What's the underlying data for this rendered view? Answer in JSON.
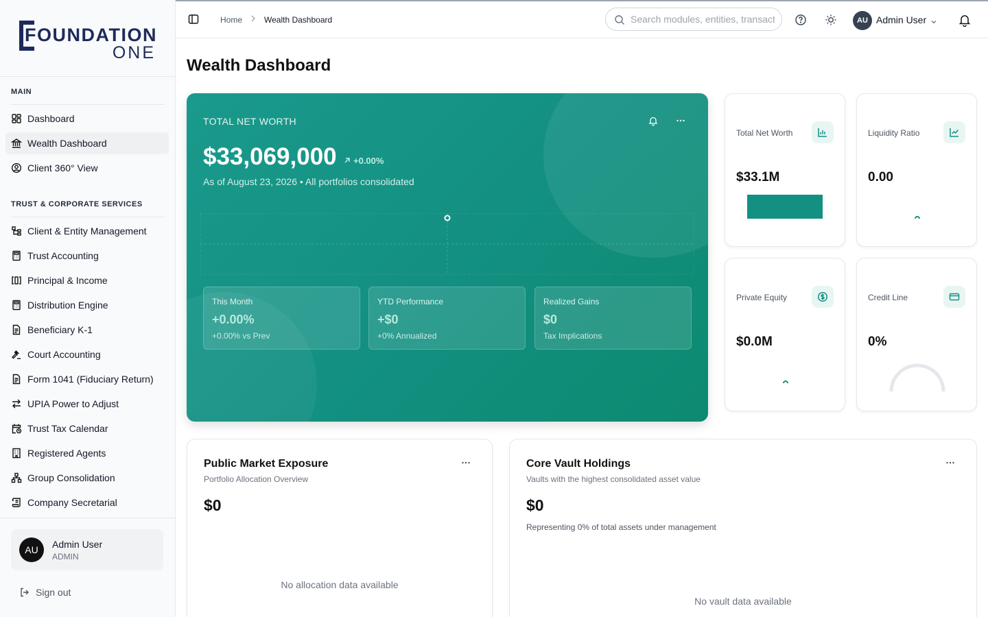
{
  "app": {
    "logo_word1": "FOUNDATION",
    "logo_word2": "ONE"
  },
  "sidebar": {
    "sections": [
      {
        "title": "MAIN"
      },
      {
        "title": "TRUST & CORPORATE SERVICES"
      }
    ],
    "main_items": [
      {
        "label": "Dashboard",
        "icon": "dashboard-grid-icon",
        "active": false
      },
      {
        "label": "Wealth Dashboard",
        "icon": "bank-icon",
        "active": true
      },
      {
        "label": "Client 360° View",
        "icon": "user-circle-icon",
        "active": false
      }
    ],
    "trust_items": [
      {
        "label": "Client & Entity Management",
        "icon": "hierarchy-icon"
      },
      {
        "label": "Trust Accounting",
        "icon": "calculator-icon"
      },
      {
        "label": "Principal & Income",
        "icon": "split-columns-icon"
      },
      {
        "label": "Distribution Engine",
        "icon": "calculator-icon"
      },
      {
        "label": "Beneficiary K-1",
        "icon": "document-icon"
      },
      {
        "label": "Court Accounting",
        "icon": "gavel-icon"
      },
      {
        "label": "Form 1041 (Fiduciary Return)",
        "icon": "document-icon"
      },
      {
        "label": "UPIA Power to Adjust",
        "icon": "arrows-exchange-icon"
      },
      {
        "label": "Trust Tax Calendar",
        "icon": "calendar-clock-icon"
      },
      {
        "label": "Registered Agents",
        "icon": "building-icon"
      },
      {
        "label": "Group Consolidation",
        "icon": "network-icon"
      },
      {
        "label": "Company Secretarial",
        "icon": "scroll-icon"
      }
    ],
    "user": {
      "initials": "AU",
      "name": "Admin User",
      "role": "ADMIN"
    },
    "signout_label": "Sign out"
  },
  "header": {
    "breadcrumb": [
      "Home",
      "Wealth Dashboard"
    ],
    "search_placeholder": "Search modules, entities, transactions...",
    "user_initials": "AU",
    "user_name": "Admin User"
  },
  "main": {
    "page_title": "Wealth Dashboard",
    "hero": {
      "label": "TOTAL NET WORTH",
      "value": "$33,069,000",
      "delta": "+0.00%",
      "as_of": "As of August 23, 2026 • All portfolios consolidated",
      "stats": [
        {
          "title": "This Month",
          "value": "+0.00%",
          "sub": "+0.00% vs Prev"
        },
        {
          "title": "YTD Performance",
          "value": "+$0",
          "sub": "+0% Annualized"
        },
        {
          "title": "Realized Gains",
          "value": "$0",
          "sub": "Tax Implications"
        }
      ]
    },
    "kpis": [
      {
        "title": "Total Net Worth",
        "value": "$33.1M",
        "icon": "bar-chart-icon"
      },
      {
        "title": "Liquidity Ratio",
        "value": "0.00",
        "icon": "line-chart-icon"
      },
      {
        "title": "Private Equity",
        "value": "$0.0M",
        "icon": "dollar-circle-icon"
      },
      {
        "title": "Credit Line",
        "value": "0%",
        "icon": "credit-card-icon"
      }
    ],
    "public_market": {
      "title": "Public Market Exposure",
      "subtitle": "Portfolio Allocation Overview",
      "value": "$0",
      "empty": "No allocation data available"
    },
    "core_vault": {
      "title": "Core Vault Holdings",
      "subtitle": "Vaults with the highest consolidated asset value",
      "value": "$0",
      "representing": "Representing 0% of total assets under management",
      "empty": "No vault data available"
    }
  },
  "colors": {
    "accent": "#139082",
    "accent_light": "#e8f6f3",
    "brand_navy": "#1e2a5a"
  }
}
